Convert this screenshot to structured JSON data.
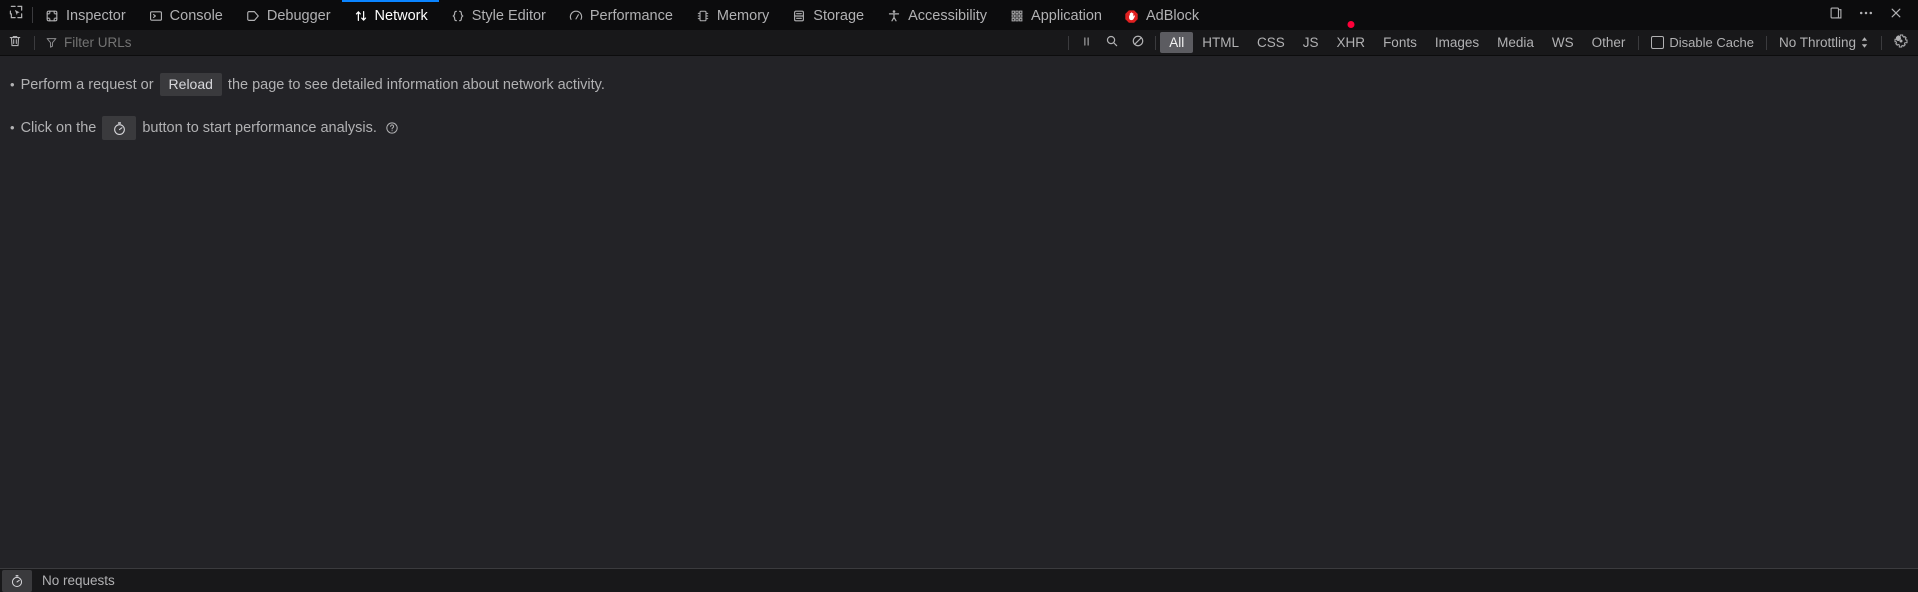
{
  "toolbox": {
    "picker_icon": "element-picker-icon",
    "tabs": [
      {
        "id": "inspector",
        "label": "Inspector",
        "icon": "inspector-icon",
        "selected": false
      },
      {
        "id": "console",
        "label": "Console",
        "icon": "console-icon",
        "selected": false
      },
      {
        "id": "debugger",
        "label": "Debugger",
        "icon": "debugger-icon",
        "selected": false
      },
      {
        "id": "network",
        "label": "Network",
        "icon": "network-icon",
        "selected": true
      },
      {
        "id": "styleeditor",
        "label": "Style Editor",
        "icon": "braces-icon",
        "selected": false
      },
      {
        "id": "performance",
        "label": "Performance",
        "icon": "gauge-icon",
        "selected": false
      },
      {
        "id": "memory",
        "label": "Memory",
        "icon": "memory-chip-icon",
        "selected": false
      },
      {
        "id": "storage",
        "label": "Storage",
        "icon": "database-icon",
        "selected": false
      },
      {
        "id": "accessibility",
        "label": "Accessibility",
        "icon": "accessibility-icon",
        "selected": false
      },
      {
        "id": "application",
        "label": "Application",
        "icon": "grid-dots-icon",
        "selected": false
      },
      {
        "id": "adblock",
        "label": "AdBlock",
        "icon": "adblock-icon",
        "selected": false
      }
    ],
    "controls": [
      {
        "id": "dock",
        "name": "dock-position-icon"
      },
      {
        "id": "meatball",
        "name": "more-options-icon"
      },
      {
        "id": "close",
        "name": "close-icon"
      }
    ],
    "accent_color": "#0a84ff",
    "adblock_color": "#e02020"
  },
  "network_toolbar": {
    "clear_icon": "trash-icon",
    "filter": {
      "icon": "filter-funnel-icon",
      "value": "",
      "placeholder": "Filter URLs"
    },
    "pause_icon": "pause-icon",
    "search_icon": "search-icon",
    "block_icon": "block-requests-icon",
    "type_filters": [
      {
        "label": "All",
        "checked": true,
        "dots": false
      },
      {
        "label": "HTML",
        "checked": false,
        "dots": false
      },
      {
        "label": "CSS",
        "checked": false,
        "dots": false
      },
      {
        "label": "JS",
        "checked": false,
        "dots": false
      },
      {
        "label": "XHR",
        "checked": false,
        "dots": true
      },
      {
        "label": "Fonts",
        "checked": false,
        "dots": false
      },
      {
        "label": "Images",
        "checked": false,
        "dots": false
      },
      {
        "label": "Media",
        "checked": false,
        "dots": false
      },
      {
        "label": "WS",
        "checked": false,
        "dots": false
      },
      {
        "label": "Other",
        "checked": false,
        "dots": false
      }
    ],
    "dot_color": "#ff0039",
    "disable_cache": {
      "label": "Disable Cache",
      "checked": false
    },
    "throttling": {
      "value": "No Throttling",
      "icon": "updown-arrows-icon"
    },
    "settings_icon": "gear-icon"
  },
  "main": {
    "hint1": {
      "bullet": "•",
      "before": "Perform a request or",
      "button_label": "Reload",
      "after": "the page to see detailed information about network activity."
    },
    "hint2": {
      "bullet": "•",
      "before": "Click on the",
      "button_icon": "stopwatch-icon",
      "after": "button to start performance analysis.",
      "help_icon": "help-circle-icon"
    }
  },
  "statusbar": {
    "perf_icon": "stopwatch-icon",
    "status_text": "No requests"
  }
}
